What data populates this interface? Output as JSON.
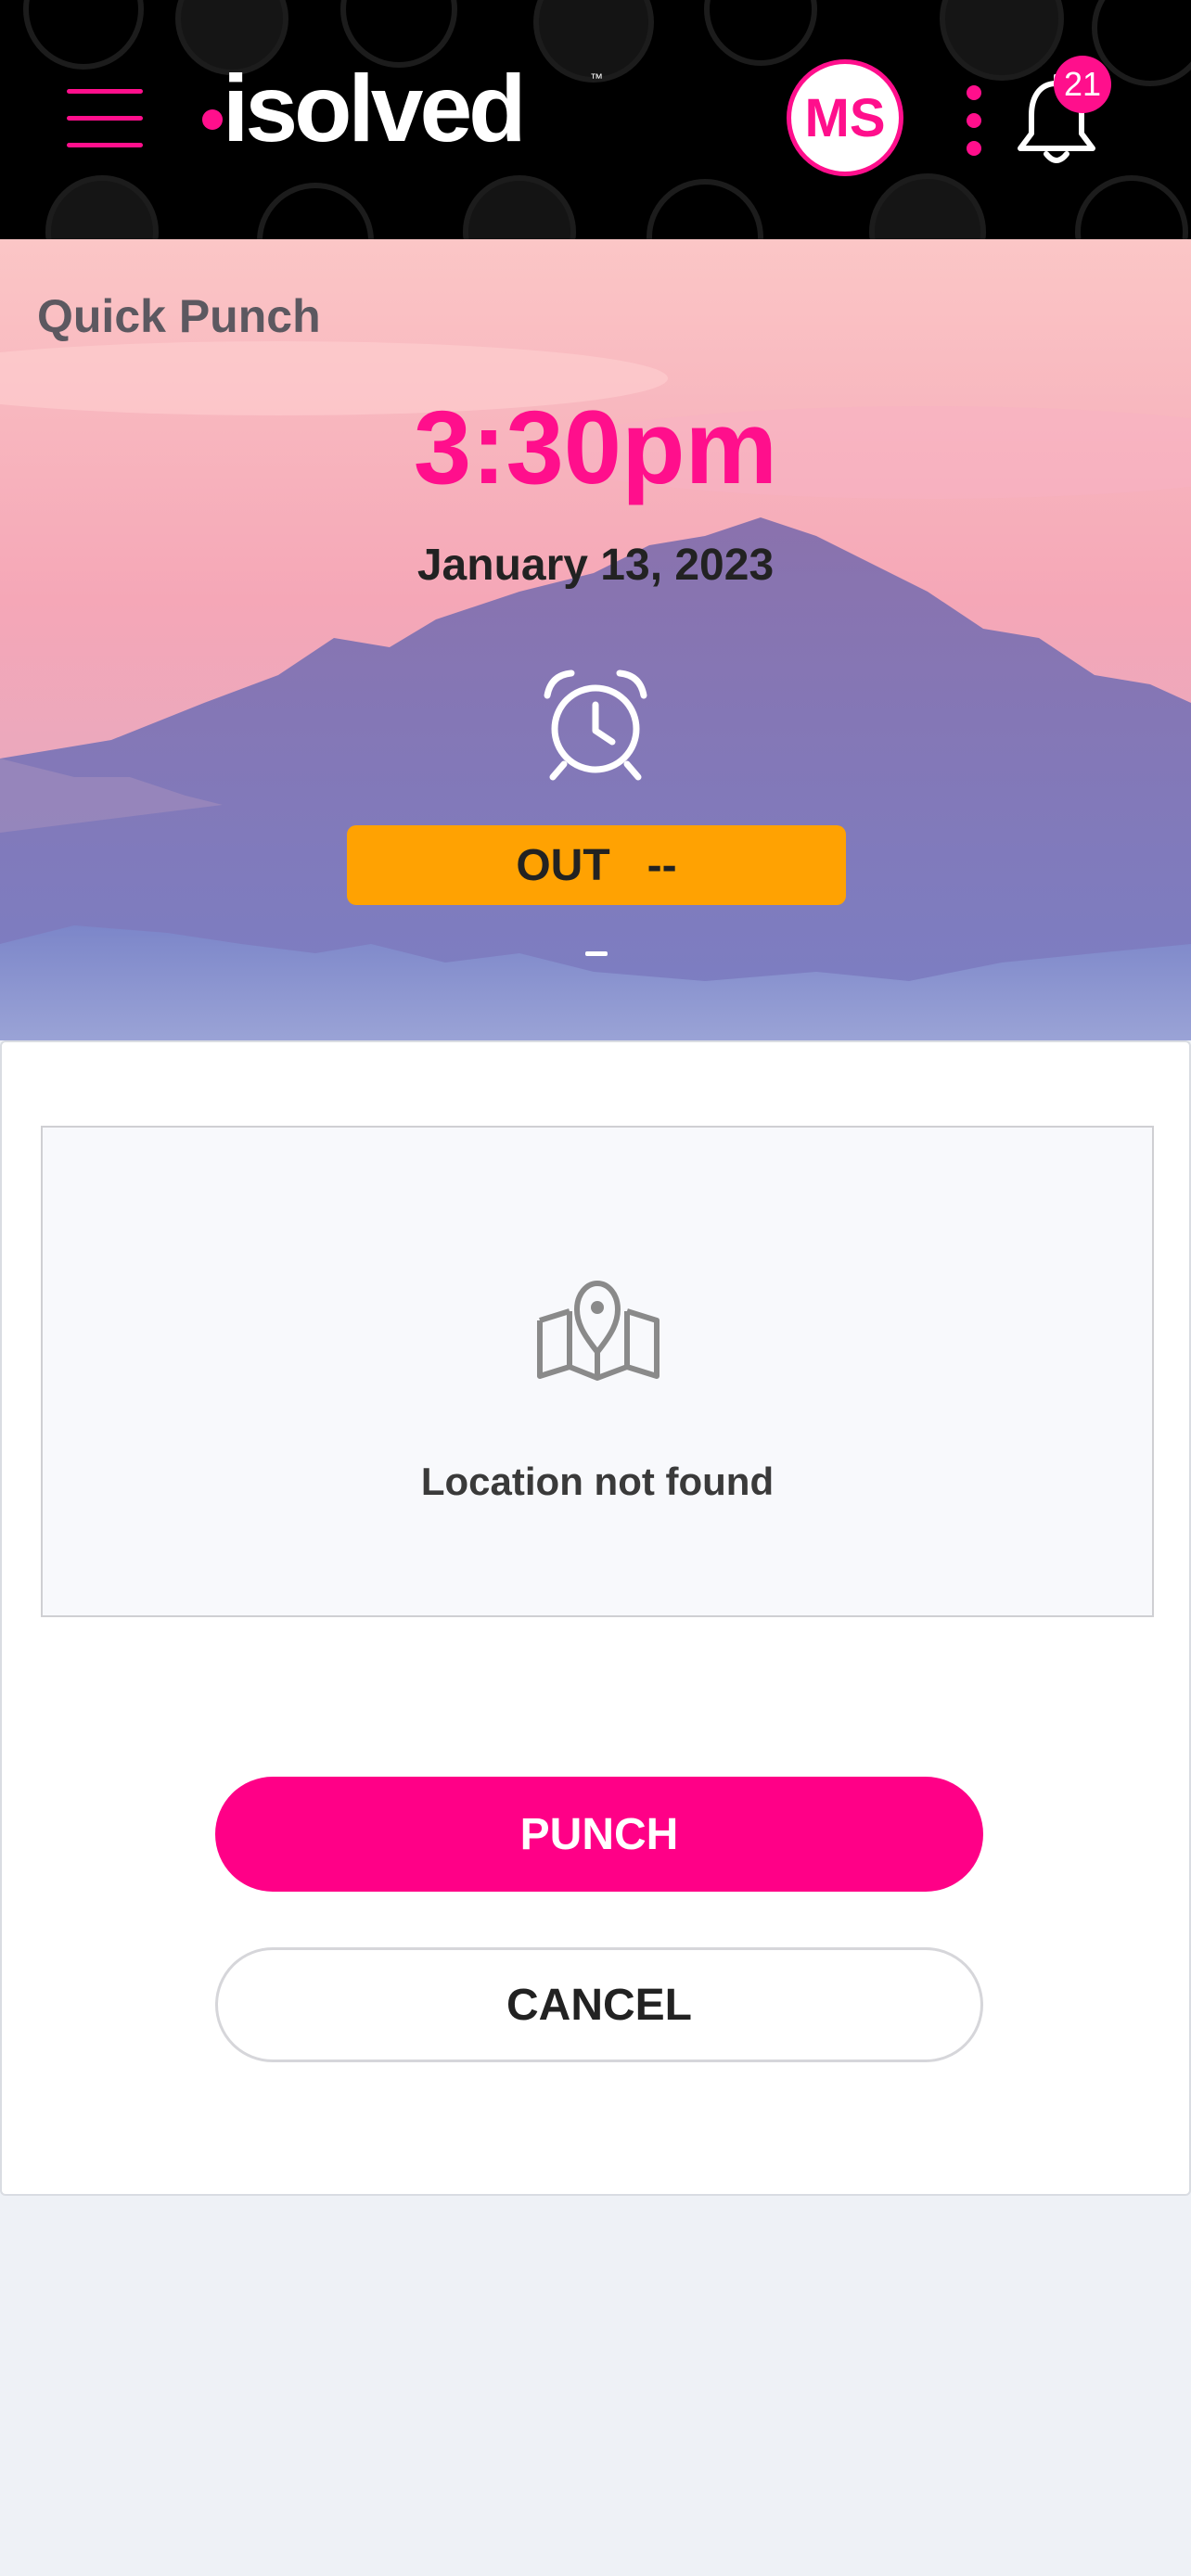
{
  "header": {
    "logo_text": "isolved",
    "logo_tm": "™",
    "avatar_initials": "MS",
    "notification_count": "21",
    "brand_color": "#ff0f8c"
  },
  "hero": {
    "title": "Quick Punch",
    "time": "3:30pm",
    "date": "January 13, 2023",
    "status_label": "OUT",
    "status_value": "--",
    "status_color": "#ffa202",
    "icon": "alarm-clock-icon"
  },
  "location": {
    "icon": "map-pin-icon",
    "message": "Location not found"
  },
  "actions": {
    "punch_label": "PUNCH",
    "cancel_label": "CANCEL"
  }
}
